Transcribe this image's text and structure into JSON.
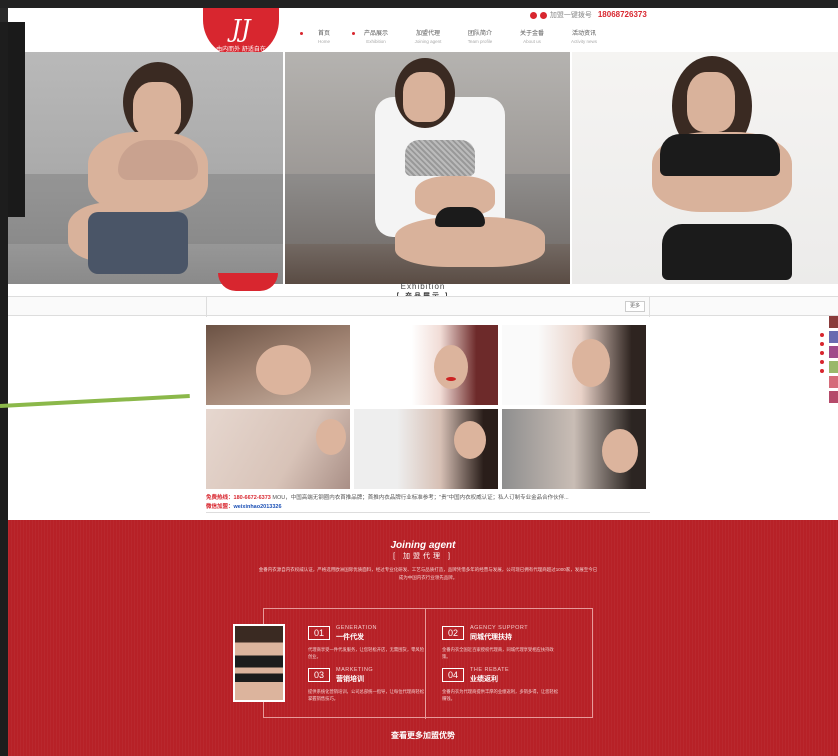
{
  "header": {
    "logo_mark": "JJ",
    "logo_tag": "贵族",
    "logo_slogan": "由内而外  舒适自在",
    "hotline_label": "加盟一键拨号",
    "hotline_number": "18068726373",
    "nav": [
      {
        "cn": "首页",
        "en": "Home"
      },
      {
        "cn": "产品展示",
        "en": "Exhibition"
      },
      {
        "cn": "加盟代理",
        "en": "Joining agent"
      },
      {
        "cn": "团队简介",
        "en": "Team profile"
      },
      {
        "cn": "关于金番",
        "en": "About us"
      },
      {
        "cn": "活动资讯",
        "en": "Activity news"
      }
    ]
  },
  "exhibition": {
    "title_en": "Exhibition",
    "title_cn": "[ 产品展示 ]",
    "more": "更多"
  },
  "contact": {
    "hotline_label": "免费热线：",
    "hotline": "180-6672-6373",
    "info": "MOU，中国高端无钢圈内衣首推品牌；首推内衣品牌行业标准参考；\"贵\"中国内衣权威认证；私人订制专业金品合作伙伴...",
    "wechat_label": "微信加盟：",
    "wechat_id": "weixinhao2013326"
  },
  "join": {
    "title_en": "Joining agent",
    "title_cn": "[ 加盟代理 ]",
    "desc": "金番内衣源自内衣权威认证，严格选用欧洲国际优质面料，经过专业化研发、工艺与品质打造，品牌凭借多年的经营与发展，公司现已拥有代理商超过1000家，发展至今已成为中国内衣行业领先品牌。",
    "features": [
      {
        "num": "01",
        "en": "GENERATION",
        "cn": "一件代发",
        "txt": "代理商享受一件代发服务，让您轻松开店，无需囤货，零风险创业。"
      },
      {
        "num": "02",
        "en": "AGENCY SUPPORT",
        "cn": "同城代理扶持",
        "txt": "金番内衣全国近百家授权代理商，同城代理享受相应扶持政策。"
      },
      {
        "num": "03",
        "en": "MARKETING",
        "cn": "营销培训",
        "txt": "提供系统化营销培训，公司总部统一指导，让每位代理商轻松掌握销售技巧。"
      },
      {
        "num": "04",
        "en": "THE REBATE",
        "cn": "业绩返利",
        "txt": "金番内衣为代理商提供丰厚的业绩返利，多销多得，让您轻松赚钱。"
      }
    ],
    "more": "查看更多加盟优势"
  },
  "colors": {
    "brand_red": "#d8262f",
    "section_red": "#b72127",
    "accent_green": "#8bb84a"
  }
}
